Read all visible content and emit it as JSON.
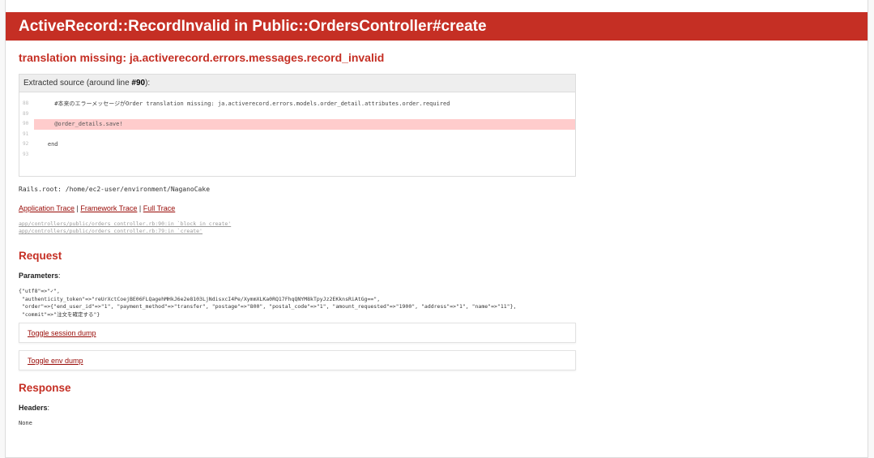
{
  "header": {
    "title": "ActiveRecord::RecordInvalid in Public::OrdersController#create"
  },
  "error_message": "translation missing: ja.activerecord.errors.messages.record_invalid",
  "source": {
    "info_prefix": "Extracted source (around line ",
    "line_ref": "#90",
    "info_suffix": "):",
    "lines": [
      {
        "num": "88",
        "code": "      #本来のエラーメッセージがOrder translation missing: ja.activerecord.errors.models.order_detail.attributes.order.required",
        "highlight": false
      },
      {
        "num": "89",
        "code": "",
        "highlight": false
      },
      {
        "num": "90",
        "code": "      @order_details.save!",
        "highlight": true
      },
      {
        "num": "91",
        "code": "",
        "highlight": false
      },
      {
        "num": "92",
        "code": "    end",
        "highlight": false
      },
      {
        "num": "93",
        "code": "",
        "highlight": false
      }
    ]
  },
  "rails_root": "Rails.root: /home/ec2-user/environment/NaganoCake",
  "trace_links": {
    "application": "Application Trace",
    "separator1": " | ",
    "framework": "Framework Trace",
    "separator2": " | ",
    "full": "Full Trace"
  },
  "trace": [
    {
      "path": "app/controllers/public/orders_controller.rb:90:in `block in create'"
    },
    {
      "path": "app/controllers/public/orders_controller.rb:79:in `create'"
    }
  ],
  "request": {
    "title": "Request",
    "parameters_label": "Parameters",
    "parameters_colon": ":",
    "parameters_text": "{\"utf8\"=>\"✓\",\n \"authenticity_token\"=>\"reUrXctCoejBE06FLQagehMHkJ6e2e8103LjNdisxcI4Pe/XymmXLKa0RQ17FhqQNYM8kTpyJz2EKknsRiAtGg==\",\n \"order\"=>{\"end_user_id\"=>\"1\", \"payment_method\"=>\"transfer\", \"postage\"=>\"800\", \"postal_code\"=>\"1\", \"amount_requested\"=>\"1900\", \"address\"=>\"1\", \"name\"=>\"11\"},\n \"commit\"=>\"注文を確定する\"}",
    "toggle_session": "Toggle session dump",
    "toggle_env": "Toggle env dump"
  },
  "response": {
    "title": "Response",
    "headers_label": "Headers",
    "headers_colon": ":",
    "headers_value": "None"
  }
}
